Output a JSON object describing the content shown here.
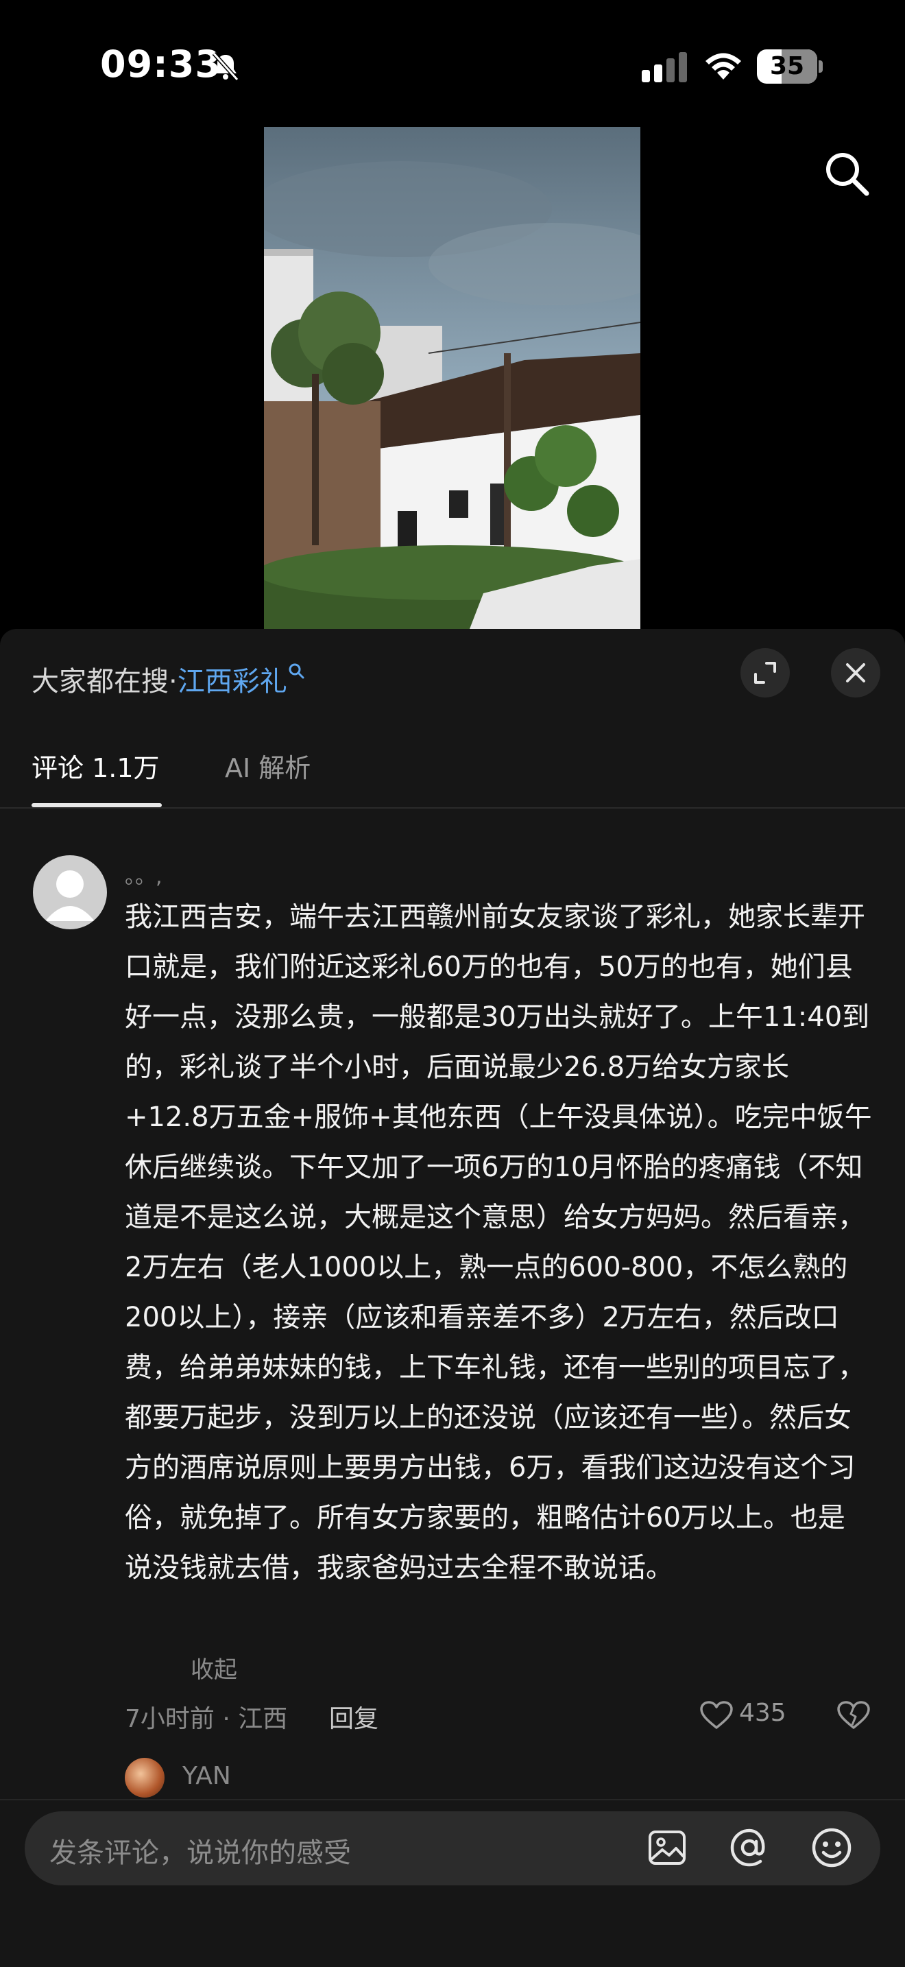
{
  "status_bar": {
    "time": "09:33",
    "battery": "35"
  },
  "sheet": {
    "trending_prefix": "大家都在搜·",
    "trending_term": "江西彩礼",
    "tabs": [
      {
        "label": "评论 1.1万",
        "active": true
      },
      {
        "label": "AI 解析",
        "active": false
      }
    ]
  },
  "comment": {
    "username": "。。,",
    "text": "我江西吉安，端午去江西赣州前女友家谈了彩礼，她家长辈开口就是，我们附近这彩礼60万的也有，50万的也有，她们县好一点，没那么贵，一般都是30万出头就好了。上午11:40到的，彩礼谈了半个小时，后面说最少26.8万给女方家长+12.8万五金+服饰+其他东西（上午没具体说）。吃完中饭午休后继续谈。下午又加了一项6万的10月怀胎的疼痛钱（不知道是不是这么说，大概是这个意思）给女方妈妈。然后看亲，2万左右（老人1000以上，熟一点的600-800，不怎么熟的200以上），接亲（应该和看亲差不多）2万左右，然后改口费，给弟弟妹妹的钱，上下车礼钱，还有一些别的项目忘了，都要万起步，没到万以上的还没说（应该还有一些）。然后女方的酒席说原则上要男方出钱，6万，看我们这边没有这个习俗，就免掉了。所有女方家要的，粗略估计60万以上。也是说没钱就去借，我家爸妈过去全程不敢说话。",
    "collapse_label": "收起",
    "meta": "7小时前 · 江西",
    "reply_label": "回复",
    "likes": "435",
    "reply_preview_name": "YAN"
  },
  "input": {
    "placeholder": "发条评论，说说你的感受"
  },
  "icons": {
    "top_right": "search-icon",
    "bottom": [
      "image-icon",
      "at-icon",
      "emoji-icon"
    ]
  }
}
